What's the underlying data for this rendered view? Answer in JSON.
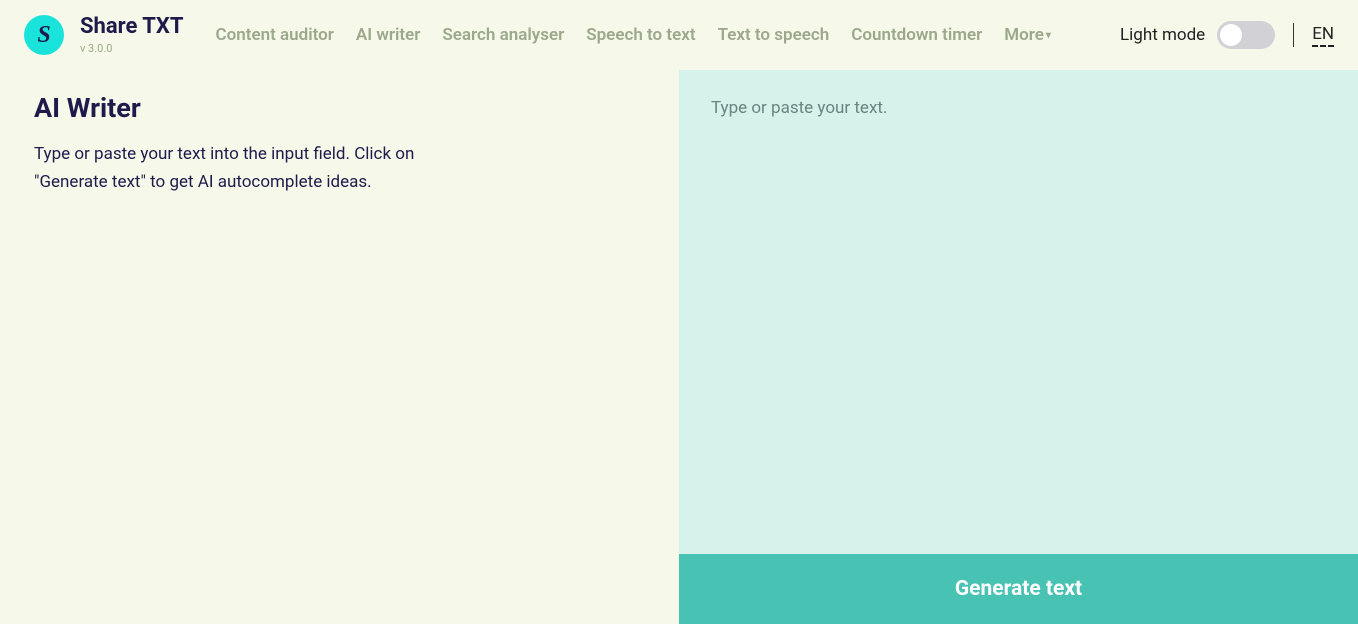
{
  "header": {
    "logo_letter": "S",
    "title": "Share TXT",
    "version": "v 3.0.0",
    "nav": [
      "Content auditor",
      "AI writer",
      "Search analyser",
      "Speech to text",
      "Text to speech",
      "Countdown timer"
    ],
    "more_label": "More",
    "light_mode_label": "Light mode",
    "lang": "EN"
  },
  "main": {
    "title": "AI Writer",
    "description": "Type or paste your text into the input field. Click on \"Generate text\" to get AI autocomplete ideas.",
    "textarea_placeholder": "Type or paste your text.",
    "textarea_value": "",
    "generate_button_label": "Generate text"
  }
}
